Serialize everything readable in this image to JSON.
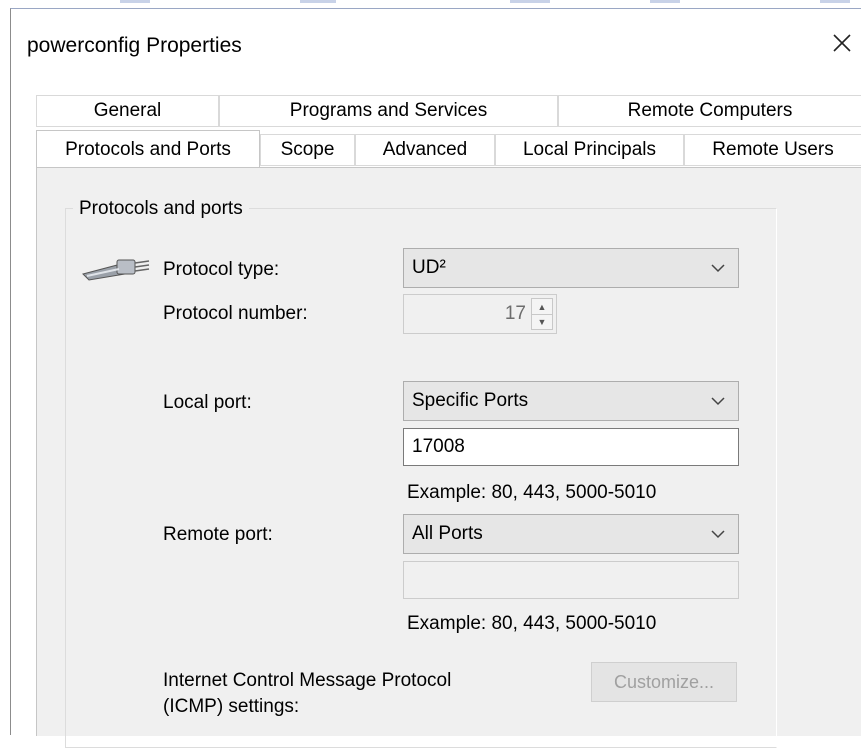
{
  "window": {
    "title": "powerconfig Properties"
  },
  "tabs_row1": [
    {
      "label": "General"
    },
    {
      "label": "Programs and Services"
    },
    {
      "label": "Remote Computers"
    }
  ],
  "tabs_row2": [
    {
      "label": "Protocols and Ports",
      "active": true
    },
    {
      "label": "Scope"
    },
    {
      "label": "Advanced"
    },
    {
      "label": "Local Principals"
    },
    {
      "label": "Remote Users"
    }
  ],
  "group": {
    "title": "Protocols and ports",
    "protocol_type_label": "Protocol type:",
    "protocol_type_value": "UD²",
    "protocol_number_label": "Protocol number:",
    "protocol_number_value": "17",
    "local_port_label": "Local port:",
    "local_port_value": "Specific Ports",
    "local_port_text": "17008",
    "local_port_example": "Example: 80, 443, 5000-5010",
    "remote_port_label": "Remote port:",
    "remote_port_value": "All Ports",
    "remote_port_text": "",
    "remote_port_example": "Example: 80, 443, 5000-5010",
    "icmp_label_line1": "Internet Control Message Protocol",
    "icmp_label_line2": "(ICMP) settings:",
    "customize_label": "Customize..."
  },
  "icons": {
    "close": "close-icon",
    "chevron": "chevron-down-icon",
    "network_cable": "network-cable-icon"
  }
}
